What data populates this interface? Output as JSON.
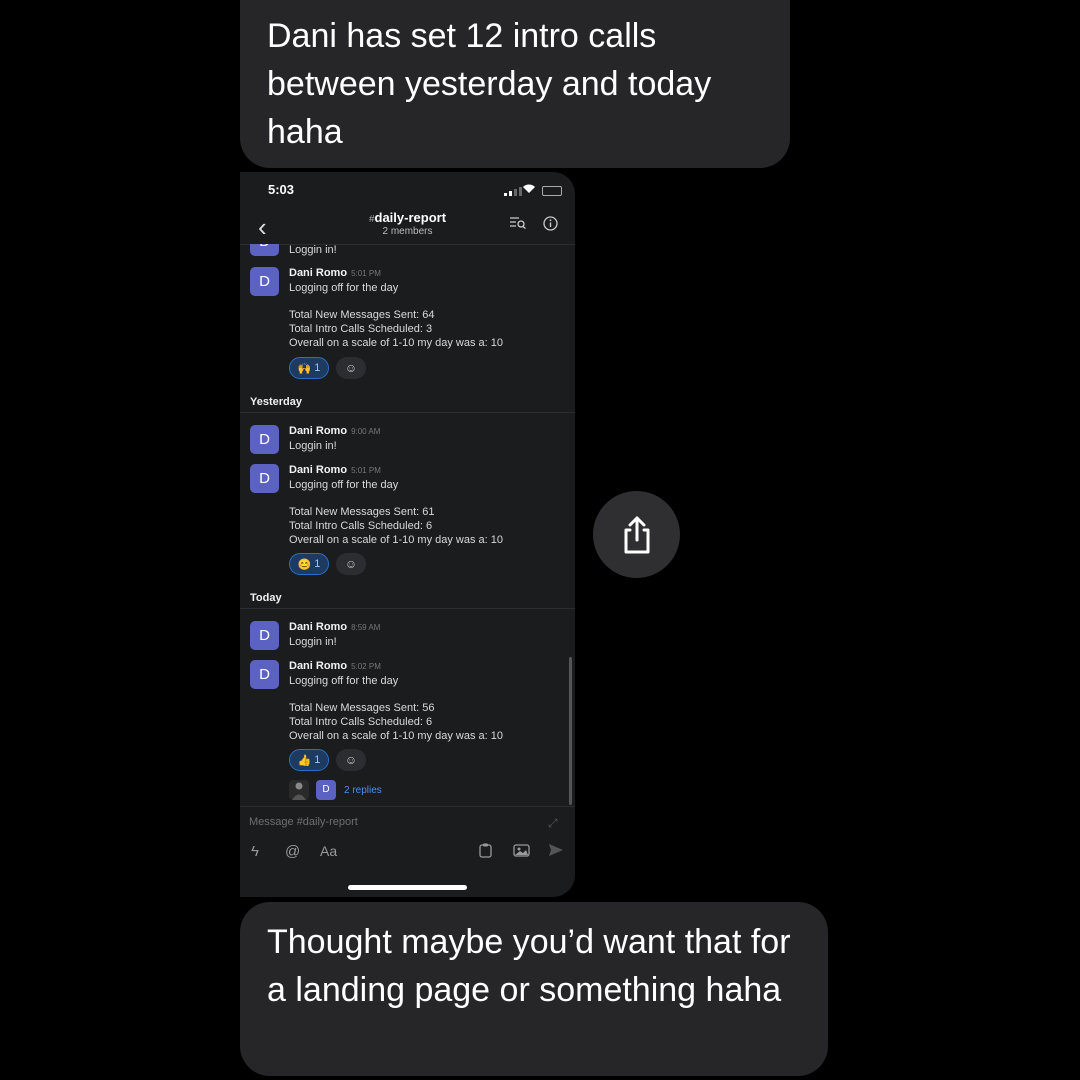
{
  "messages_thread": {
    "top_bubble": "Dani has set 12 intro calls between yesterday and today haha",
    "bottom_bubble": "Thought maybe you’d want that for a landing page or something haha"
  },
  "phone": {
    "status_time": "5:03",
    "channel": {
      "hash": "#",
      "name": "daily-report",
      "members": "2 members"
    },
    "partial_top_text": "Loggin in!",
    "blocks": [
      {
        "avatar": "D",
        "name": "Dani Romo",
        "time": "5:01 PM",
        "lines": [
          "Logging off for the day"
        ],
        "stats": [
          "Total New Messages Sent: 64",
          "Total Intro Calls Scheduled: 3",
          "Overall on a scale of 1-10 my day was a: 10"
        ],
        "reaction": {
          "emoji": "🙌",
          "count": "1"
        }
      }
    ],
    "yesterday": {
      "label": "Yesterday",
      "login": {
        "avatar": "D",
        "name": "Dani Romo",
        "time": "9:00 AM",
        "text": "Loggin in!"
      },
      "logoff": {
        "avatar": "D",
        "name": "Dani Romo",
        "time": "5:01 PM",
        "text": "Logging off for the day",
        "stats": [
          "Total New Messages Sent: 61",
          "Total Intro Calls Scheduled: 6",
          "Overall on a scale of 1-10 my day was a: 10"
        ],
        "reaction": {
          "emoji": "😊",
          "count": "1"
        }
      }
    },
    "today": {
      "label": "Today",
      "login": {
        "avatar": "D",
        "name": "Dani Romo",
        "time": "8:59 AM",
        "text": "Loggin in!"
      },
      "logoff": {
        "avatar": "D",
        "name": "Dani Romo",
        "time": "5:02 PM",
        "text": "Logging off for the day",
        "stats": [
          "Total New Messages Sent: 56",
          "Total Intro Calls Scheduled: 6",
          "Overall on a scale of 1-10 my day was a: 10"
        ],
        "reaction": {
          "emoji": "👍",
          "count": "1"
        },
        "reply_avatar": "D",
        "replies": "2 replies"
      }
    },
    "add_reaction_icon": "☺",
    "composer": {
      "placeholder": "Message #daily-report",
      "tools": {
        "shortcuts": "ϟ",
        "mention": "@",
        "format": "Aa"
      }
    }
  },
  "icons": {
    "share": "share-icon",
    "back": "chevron-left-icon",
    "search_in_channel": "search-list-icon",
    "info": "info-icon"
  }
}
